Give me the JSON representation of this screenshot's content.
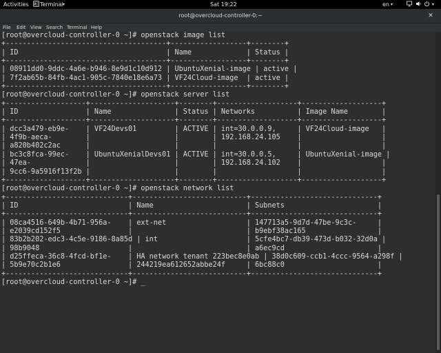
{
  "topbar": {
    "activities": "Activities",
    "app_name": "Terminal",
    "clock": "Sat 19:22",
    "language": "en"
  },
  "window": {
    "title": "root@overcloud-controller-0:~"
  },
  "menu": {
    "file": "File",
    "edit": "Edit",
    "view": "View",
    "search": "Search",
    "terminal": "Terminal",
    "help": "Help"
  },
  "terminal": {
    "lines": [
      "[root@overcloud-controller-0 ~]# openstack image list",
      "+--------------------------------------+------------------+--------+",
      "| ID                                   | Name             | Status |",
      "+--------------------------------------+------------------+--------+",
      "| 08911dd0-9ddc-4a6e-b946-8e9d1c10d912 | UbuntuXenial-image | active |",
      "| 7f2ab65b-84fb-4ac1-905c-7840e18e6a73 | VF24Cloud-image  | active |",
      "+--------------------------------------+------------------+--------+",
      "[root@overcloud-controller-0 ~]# openstack server list",
      "+-------------------+--------------------+--------+-------------------+-------------------+",
      "| ID                | Name               | Status | Networks          | Image Name        |",
      "+-------------------+--------------------+--------+-------------------+-------------------+",
      "| dcc3a479-eb9e-    | VF24Devs01         | ACTIVE | int=30.0.0.9,     | VF24Cloud-image   |",
      "| 4f9b-aeca-        |                    |        | 192.168.24.105    |                   |",
      "| a820b402c2ac      |                    |        |                   |                   |",
      "| bc3c8fca-99ec-    | UbuntuXenialDevs01 | ACTIVE | int=30.0.0.5,     | UbuntuXenial-image |",
      "| 47ea-             |                    |        | 192.168.24.102    |                   |",
      "| 9cc6-9a5916f13f2b |                    |        |                   |                   |",
      "+-------------------+--------------------+--------+-------------------+-------------------+",
      "[root@overcloud-controller-0 ~]# openstack network list",
      "+-----------------------------+---------------------------+------------------------------+",
      "| ID                          | Name                      | Subnets                      |",
      "+-----------------------------+---------------------------+------------------------------+",
      "| 08ca4516-649b-4b71-956a-    | ext-net                   | 147713a5-9d7d-47be-9c3c-     |",
      "| e2039cd152f5                |                           | b9ebf38ac165                 |",
      "| 83b2b202-edc3-4c5e-9186-8a85d | int                     | 5cfe4bc7-db39-473d-b032-32d0a |",
      "| 98b9048                     |                           | a6ec9cd                      |",
      "| d25ffeca-36c8-4fcd-bf1e-    | HA network tenant 223bec8e0ab | 38d0c609-ccb1-4ccc-9564-a298f |",
      "| 5b9e70c2b1e6                | 244219ea612652abbe24f     | 6bc88c0                      |",
      "+-----------------------------+---------------------------+------------------------------+",
      "[root@overcloud-controller-0 ~]# _"
    ]
  }
}
